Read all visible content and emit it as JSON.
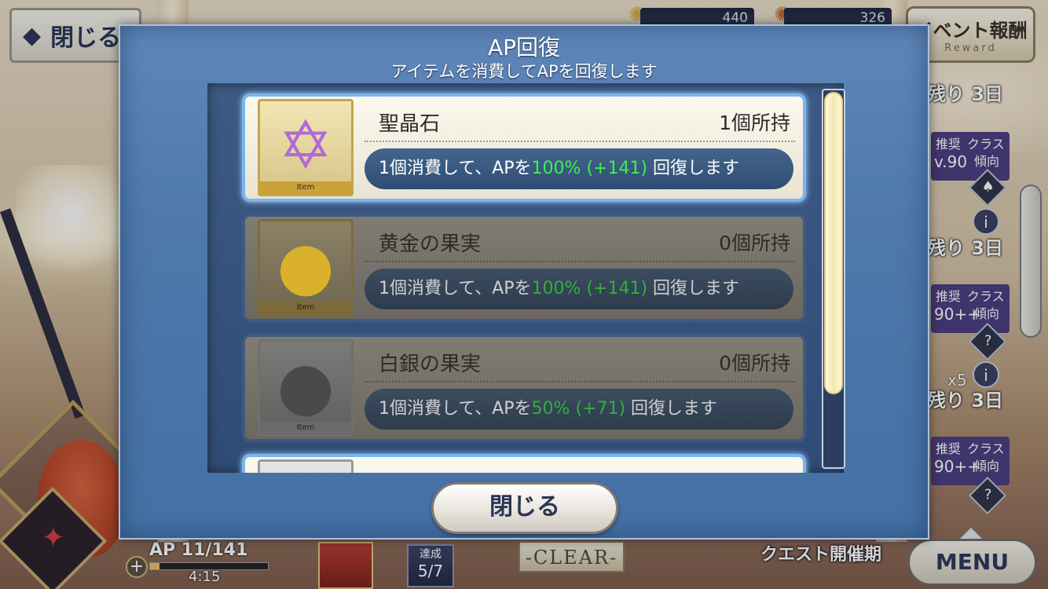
{
  "background": {
    "back_label": "閉じる",
    "resources": [
      {
        "icon": "gold-fou-icon",
        "value": "440"
      },
      {
        "icon": "silver-fou-icon",
        "value": "326"
      }
    ],
    "event_reward": {
      "line1": "イベント報酬",
      "line2": "Reward"
    },
    "quests": [
      {
        "remaining": "残り 3日",
        "rec1": "推奨",
        "rec2": "クラス",
        "level": "v.90",
        "tendency": "傾向"
      },
      {
        "remaining": "残り 3日",
        "rec1": "推奨",
        "rec2": "クラス",
        "level": "90++",
        "tendency": "傾向"
      },
      {
        "remaining": "残り 3日",
        "rec1": "推奨",
        "rec2": "クラス",
        "level": "90++",
        "tendency": "傾向"
      }
    ],
    "multiplier": "x5",
    "ap_label": "AP 11/141",
    "ap_timer": "4:15",
    "ap_fraction": 0.078,
    "achieve_label": "達成",
    "achieve_value": "5/7",
    "clear_label": "-CLEAR-",
    "quest_open_label": "クエスト開催期",
    "menu_label": "MENU"
  },
  "dialog": {
    "title": "AP回復",
    "subtitle": "アイテムを消費してAPを回復します",
    "items": [
      {
        "name": "聖晶石",
        "owned": "1個所持",
        "desc_pre": "1個消費して、APを",
        "desc_amount": "100% (+141)",
        "desc_post": " 回復します",
        "icon": "saint-quartz-icon",
        "tag": "Item"
      },
      {
        "name": "黄金の果実",
        "owned": "0個所持",
        "desc_pre": "1個消費して、APを",
        "desc_amount": "100% (+141)",
        "desc_post": " 回復します",
        "icon": "golden-apple-icon",
        "tag": "Item"
      },
      {
        "name": "白銀の果実",
        "owned": "0個所持",
        "desc_pre": "1個消費して、APを",
        "desc_amount": "50% (+71)",
        "desc_post": " 回復します",
        "icon": "silver-apple-icon",
        "tag": "Item"
      }
    ],
    "close_label": "閉じる"
  },
  "colors": {
    "dialog_blue": "#4f78ab",
    "highlight_border": "#78b6ee",
    "recovery_green": "#3df04e"
  }
}
